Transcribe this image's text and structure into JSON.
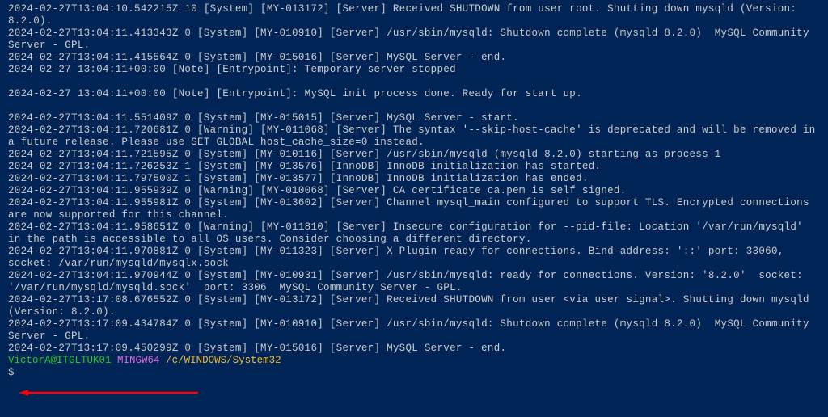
{
  "logs": [
    "2024-02-27T13:04:10.542215Z 10 [System] [MY-013172] [Server] Received SHUTDOWN from user root. Shutting down mysqld (Version: 8.2.0).",
    "2024-02-27T13:04:11.413343Z 0 [System] [MY-010910] [Server] /usr/sbin/mysqld: Shutdown complete (mysqld 8.2.0)  MySQL Community Server - GPL.",
    "2024-02-27T13:04:11.415564Z 0 [System] [MY-015016] [Server] MySQL Server - end.",
    "2024-02-27 13:04:11+00:00 [Note] [Entrypoint]: Temporary server stopped",
    "",
    "2024-02-27 13:04:11+00:00 [Note] [Entrypoint]: MySQL init process done. Ready for start up.",
    "",
    "2024-02-27T13:04:11.551409Z 0 [System] [MY-015015] [Server] MySQL Server - start.",
    "2024-02-27T13:04:11.720681Z 0 [Warning] [MY-011068] [Server] The syntax '--skip-host-cache' is deprecated and will be removed in a future release. Please use SET GLOBAL host_cache_size=0 instead.",
    "2024-02-27T13:04:11.721595Z 0 [System] [MY-010116] [Server] /usr/sbin/mysqld (mysqld 8.2.0) starting as process 1",
    "2024-02-27T13:04:11.726253Z 1 [System] [MY-013576] [InnoDB] InnoDB initialization has started.",
    "2024-02-27T13:04:11.797500Z 1 [System] [MY-013577] [InnoDB] InnoDB initialization has ended.",
    "2024-02-27T13:04:11.955939Z 0 [Warning] [MY-010068] [Server] CA certificate ca.pem is self signed.",
    "2024-02-27T13:04:11.955981Z 0 [System] [MY-013602] [Server] Channel mysql_main configured to support TLS. Encrypted connections are now supported for this channel.",
    "2024-02-27T13:04:11.958651Z 0 [Warning] [MY-011810] [Server] Insecure configuration for --pid-file: Location '/var/run/mysqld' in the path is accessible to all OS users. Consider choosing a different directory.",
    "2024-02-27T13:04:11.970881Z 0 [System] [MY-011323] [Server] X Plugin ready for connections. Bind-address: '::' port: 33060, socket: /var/run/mysqld/mysqlx.sock",
    "2024-02-27T13:04:11.970944Z 0 [System] [MY-010931] [Server] /usr/sbin/mysqld: ready for connections. Version: '8.2.0'  socket: '/var/run/mysqld/mysqld.sock'  port: 3306  MySQL Community Server - GPL.",
    "2024-02-27T13:17:08.676552Z 0 [System] [MY-013172] [Server] Received SHUTDOWN from user <via user signal>. Shutting down mysqld (Version: 8.2.0).",
    "2024-02-27T13:17:09.434784Z 0 [System] [MY-010910] [Server] /usr/sbin/mysqld: Shutdown complete (mysqld 8.2.0)  MySQL Community Server - GPL.",
    "2024-02-27T13:17:09.450299Z 0 [System] [MY-015016] [Server] MySQL Server - end."
  ],
  "prompt": {
    "user": "VictorA@ITGLTUK01",
    "os": "MINGW64",
    "path": "/c/WINDOWS/System32",
    "symbol": "$"
  }
}
